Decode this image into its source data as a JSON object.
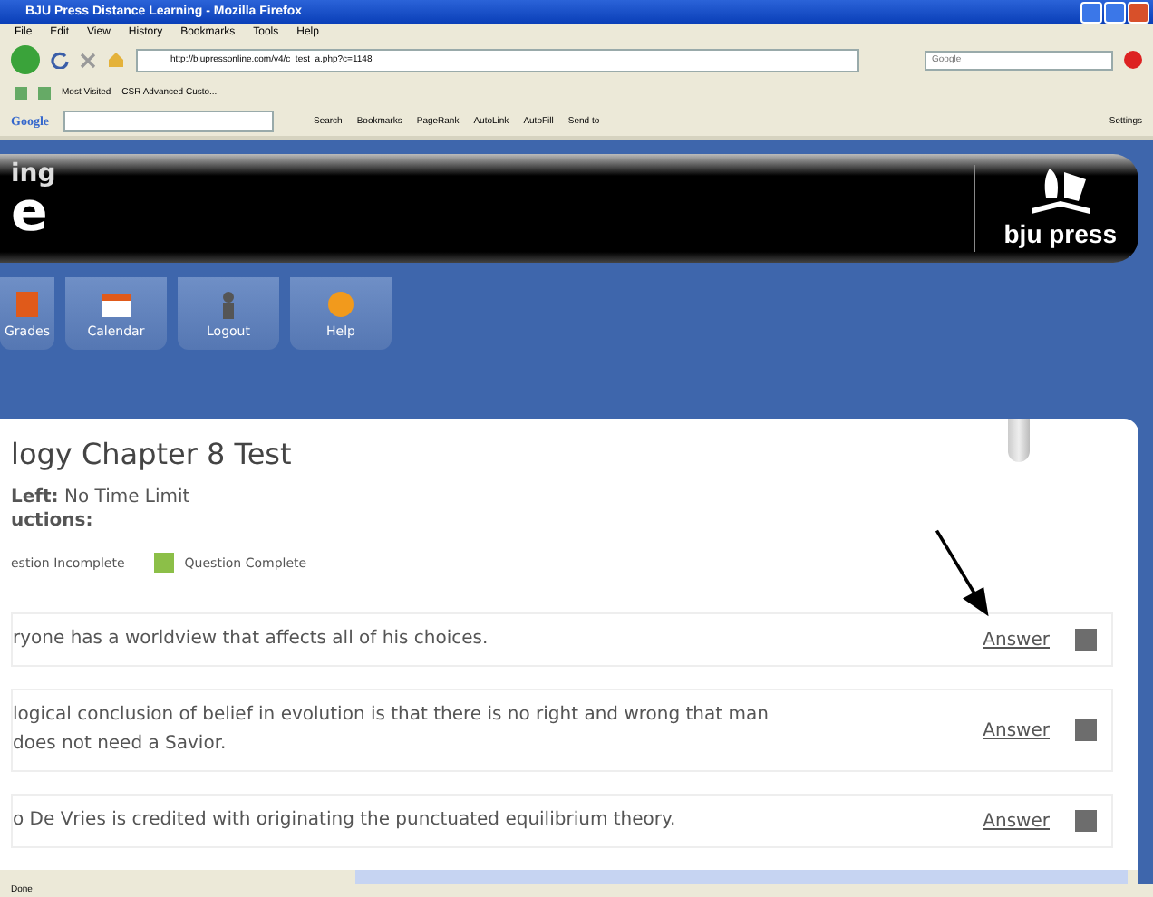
{
  "window": {
    "title": "BJU Press Distance Learning - Mozilla Firefox"
  },
  "menu": [
    "File",
    "Edit",
    "View",
    "History",
    "Bookmarks",
    "Tools",
    "Help"
  ],
  "address": {
    "url": "http://bjupressonline.com/v4/c_test_a.php?c=1148"
  },
  "search": {
    "placeholder": "Google"
  },
  "bookmarks": [
    "Most Visited",
    "CSR Advanced Custo..."
  ],
  "google_toolbar": {
    "logo": "Google",
    "items": [
      "Search",
      "Bookmarks",
      "PageRank",
      "AutoLink",
      "AutoFill",
      "Send to"
    ],
    "settings": "Settings"
  },
  "banner": {
    "line_1": "ing",
    "line_2": "e",
    "brand": "bju press"
  },
  "nav": [
    {
      "label": "Grades",
      "kind": "grades"
    },
    {
      "label": "Calendar",
      "kind": "calendar"
    },
    {
      "label": "Logout",
      "kind": "logout"
    },
    {
      "label": "Help",
      "kind": "help"
    }
  ],
  "test": {
    "title": "logy Chapter 8 Test",
    "time_label": "Left:",
    "time_value": "No Time Limit",
    "instructions": "uctions:",
    "legend": [
      {
        "label": "estion Incomplete"
      },
      {
        "label": "Question Complete",
        "color": "#8cbf48"
      }
    ]
  },
  "questions": [
    {
      "text": "ryone has a worldview that affects all of his choices.",
      "link": "Answer",
      "complete": false
    },
    {
      "text": "logical conclusion of belief in evolution is that there is no right and wrong that man does not need a Savior.",
      "link": "Answer",
      "complete": false
    },
    {
      "text": "o De Vries is credited with originating the punctuated equilibrium theory.",
      "link": "Answer",
      "complete": false
    }
  ],
  "status_bar": "Done"
}
